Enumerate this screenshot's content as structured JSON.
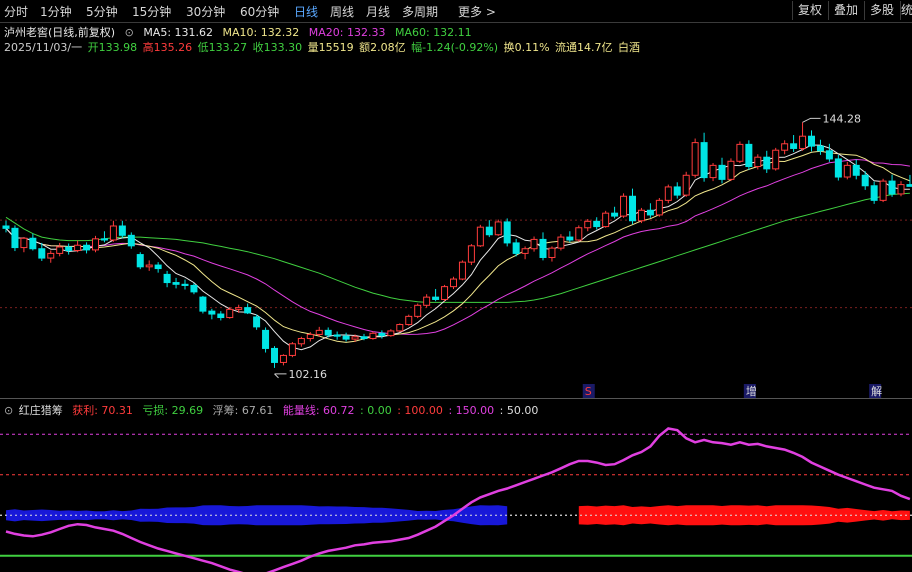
{
  "toolbar": {
    "tabs": [
      "分时",
      "1分钟",
      "5分钟",
      "15分钟",
      "30分钟",
      "60分钟",
      "日线",
      "周线",
      "月线",
      "多周期",
      "更多 >"
    ],
    "active_tab": "日线",
    "right_buttons": [
      "复权",
      "叠加",
      "多股",
      "统"
    ]
  },
  "header": {
    "stock": "泸州老窖(日线,前复权)",
    "ma5": "MA5: 131.62",
    "ma10": "MA10: 132.32",
    "ma20": "MA20: 132.33",
    "ma60": "MA60: 132.11",
    "date": "2025/11/03/一",
    "open": "开133.98",
    "high": "高135.26",
    "low": "低133.27",
    "close": "收133.30",
    "volume": "量15519",
    "amount": "额2.08亿",
    "change": "幅-1.24(-0.92%)",
    "turnover": "换0.11%",
    "float": "流通14.7亿",
    "sector": "白酒"
  },
  "indicator": {
    "name": "红庄猎筹",
    "profit": "获利: 70.31",
    "loss": "亏损: 29.69",
    "float_chips": "浮筹: 67.61",
    "energy": "能量线: 60.72",
    "v0": ": 0.00",
    "v100": ": 100.00",
    "v150": ": 150.00",
    "v50": ": 50.00"
  },
  "markers": {
    "s": "S",
    "zeng": "增",
    "jie": "解"
  },
  "colors": {
    "up": "#ff3c3c",
    "down": "#00e5e5",
    "ma5": "#e8e8e8",
    "ma10": "#f0e68c",
    "ma20": "#e040e0",
    "ma60": "#40d040",
    "energy": "#e040e0",
    "blue_band": "#1818d8",
    "red_band": "#ff1010"
  },
  "chart_data": {
    "type": "candlestick",
    "annotations": {
      "max_label": "144.28",
      "min_label": "102.16"
    },
    "candles": [
      [
        126.5,
        127.4,
        125.4,
        126.1
      ],
      [
        126.1,
        126.6,
        122.2,
        122.8
      ],
      [
        122.8,
        124.6,
        122.0,
        124.4
      ],
      [
        124.4,
        125.2,
        122.3,
        122.6
      ],
      [
        122.6,
        123.6,
        120.5,
        121.0
      ],
      [
        121.0,
        122.3,
        120.2,
        121.8
      ],
      [
        121.8,
        123.6,
        121.3,
        122.9
      ],
      [
        122.9,
        123.5,
        121.6,
        122.3
      ],
      [
        122.3,
        124.0,
        122.0,
        123.2
      ],
      [
        123.2,
        123.7,
        121.8,
        122.4
      ],
      [
        122.4,
        124.8,
        122.0,
        124.3
      ],
      [
        124.3,
        125.6,
        123.7,
        124.1
      ],
      [
        124.1,
        127.4,
        123.8,
        126.5
      ],
      [
        126.5,
        127.4,
        124.4,
        124.9
      ],
      [
        124.9,
        125.4,
        122.6,
        123.1
      ],
      [
        121.6,
        122.0,
        119.1,
        119.5
      ],
      [
        119.5,
        120.6,
        118.8,
        119.8
      ],
      [
        119.8,
        120.3,
        118.5,
        119.2
      ],
      [
        118.2,
        118.8,
        116.0,
        116.8
      ],
      [
        116.8,
        117.6,
        115.8,
        116.5
      ],
      [
        116.5,
        117.3,
        115.6,
        116.3
      ],
      [
        116.3,
        116.7,
        114.8,
        115.2
      ],
      [
        114.3,
        114.5,
        111.5,
        111.9
      ],
      [
        111.9,
        112.3,
        110.5,
        111.4
      ],
      [
        111.4,
        111.9,
        110.3,
        110.8
      ],
      [
        110.8,
        112.6,
        110.6,
        112.2
      ],
      [
        112.2,
        113.0,
        111.6,
        112.5
      ],
      [
        112.5,
        113.2,
        111.4,
        111.6
      ],
      [
        110.9,
        111.3,
        108.7,
        109.2
      ],
      [
        108.6,
        109.1,
        104.8,
        105.5
      ],
      [
        105.5,
        105.9,
        102.16,
        103.1
      ],
      [
        103.1,
        104.5,
        102.6,
        104.3
      ],
      [
        104.3,
        106.6,
        104.0,
        106.3
      ],
      [
        106.3,
        107.5,
        105.8,
        107.2
      ],
      [
        107.2,
        108.3,
        106.7,
        107.9
      ],
      [
        107.9,
        109.2,
        107.5,
        108.6
      ],
      [
        108.6,
        109.1,
        107.4,
        107.8
      ],
      [
        107.8,
        108.4,
        107.0,
        107.6
      ],
      [
        107.6,
        108.2,
        106.7,
        107.1
      ],
      [
        107.1,
        107.9,
        106.6,
        107.5
      ],
      [
        107.5,
        108.0,
        106.9,
        107.2
      ],
      [
        107.2,
        108.4,
        107.0,
        108.1
      ],
      [
        108.1,
        108.6,
        107.2,
        107.7
      ],
      [
        107.7,
        108.8,
        107.5,
        108.5
      ],
      [
        108.5,
        109.8,
        108.3,
        109.6
      ],
      [
        109.6,
        111.3,
        109.4,
        111.0
      ],
      [
        111.0,
        113.2,
        110.7,
        112.9
      ],
      [
        112.9,
        114.8,
        112.5,
        114.3
      ],
      [
        114.3,
        115.7,
        113.6,
        113.9
      ],
      [
        113.9,
        116.4,
        113.6,
        116.1
      ],
      [
        116.1,
        117.8,
        115.7,
        117.4
      ],
      [
        117.4,
        120.6,
        117.2,
        120.3
      ],
      [
        120.3,
        123.4,
        119.8,
        123.1
      ],
      [
        123.1,
        126.7,
        122.9,
        126.3
      ],
      [
        126.3,
        127.5,
        124.6,
        125.0
      ],
      [
        125.0,
        127.6,
        124.8,
        127.2
      ],
      [
        127.2,
        127.8,
        123.0,
        123.6
      ],
      [
        123.6,
        124.3,
        121.3,
        121.8
      ],
      [
        121.8,
        123.0,
        120.8,
        122.6
      ],
      [
        122.6,
        124.7,
        122.1,
        124.2
      ],
      [
        124.2,
        125.4,
        120.6,
        121.1
      ],
      [
        121.1,
        123.0,
        120.4,
        122.7
      ],
      [
        122.7,
        125.1,
        122.3,
        124.6
      ],
      [
        124.6,
        125.6,
        123.7,
        124.1
      ],
      [
        124.1,
        126.6,
        123.8,
        126.2
      ],
      [
        126.2,
        127.7,
        125.6,
        127.3
      ],
      [
        127.3,
        128.0,
        125.9,
        126.4
      ],
      [
        126.4,
        129.1,
        126.2,
        128.7
      ],
      [
        128.7,
        129.8,
        127.8,
        128.2
      ],
      [
        128.2,
        132.1,
        127.9,
        131.6
      ],
      [
        131.6,
        132.9,
        126.8,
        127.4
      ],
      [
        127.4,
        129.6,
        127.0,
        129.2
      ],
      [
        129.2,
        130.4,
        127.9,
        128.4
      ],
      [
        128.4,
        131.3,
        128.1,
        130.9
      ],
      [
        130.9,
        133.6,
        130.4,
        133.2
      ],
      [
        133.2,
        134.0,
        131.2,
        131.8
      ],
      [
        131.8,
        135.8,
        131.5,
        135.2
      ],
      [
        135.2,
        141.5,
        134.8,
        140.8
      ],
      [
        140.8,
        142.5,
        134.1,
        134.8
      ],
      [
        134.8,
        137.3,
        134.2,
        136.9
      ],
      [
        136.9,
        138.2,
        133.8,
        134.5
      ],
      [
        134.5,
        138.1,
        134.2,
        137.6
      ],
      [
        137.6,
        141.0,
        137.3,
        140.5
      ],
      [
        140.5,
        141.2,
        136.1,
        136.7
      ],
      [
        136.7,
        138.8,
        136.2,
        138.3
      ],
      [
        138.3,
        139.4,
        135.6,
        136.3
      ],
      [
        136.3,
        139.9,
        136.0,
        139.5
      ],
      [
        139.5,
        141.2,
        138.8,
        140.6
      ],
      [
        140.6,
        142.1,
        139.2,
        139.8
      ],
      [
        139.8,
        144.28,
        139.4,
        141.9
      ],
      [
        141.9,
        142.9,
        139.3,
        140.2
      ],
      [
        140.2,
        141.3,
        138.7,
        139.4
      ],
      [
        139.4,
        140.6,
        137.5,
        138.0
      ],
      [
        138.0,
        138.7,
        134.3,
        134.9
      ],
      [
        134.9,
        137.5,
        134.5,
        136.9
      ],
      [
        136.9,
        137.9,
        134.5,
        135.2
      ],
      [
        135.2,
        135.9,
        132.7,
        133.4
      ],
      [
        133.4,
        134.1,
        130.3,
        130.9
      ],
      [
        130.9,
        134.6,
        130.6,
        134.2
      ],
      [
        134.2,
        135.3,
        131.5,
        132.0
      ],
      [
        132.0,
        134.2,
        131.6,
        133.6
      ],
      [
        133.6,
        135.26,
        133.27,
        133.3
      ]
    ],
    "ma60": [
      128.0,
      127.0,
      126.0,
      125.2,
      124.6,
      124.3,
      124.1,
      124.0,
      124.0,
      124.0,
      124.1,
      124.3,
      124.5,
      124.6,
      124.6,
      124.6,
      124.5,
      124.4,
      124.3,
      124.2,
      124.0,
      123.8,
      123.6,
      123.3,
      123.0,
      122.7,
      122.4,
      122.1,
      121.7,
      121.3,
      120.9,
      120.4,
      119.9,
      119.4,
      118.9,
      118.4,
      117.8,
      117.2,
      116.6,
      116.0,
      115.5,
      115.0,
      114.6,
      114.2,
      113.9,
      113.7,
      113.5,
      113.4,
      113.4,
      113.4,
      113.4,
      113.4,
      113.4,
      113.4,
      113.4,
      113.4,
      113.4,
      113.5,
      113.6,
      113.8,
      114.1,
      114.5,
      114.9,
      115.4,
      115.9,
      116.4,
      116.9,
      117.4,
      117.9,
      118.4,
      118.9,
      119.4,
      119.9,
      120.4,
      120.9,
      121.4,
      121.9,
      122.4,
      122.9,
      123.4,
      123.9,
      124.4,
      124.9,
      125.4,
      125.9,
      126.4,
      126.9,
      127.4,
      127.8,
      128.2,
      128.6,
      129.0,
      129.4,
      129.8,
      130.2,
      130.6,
      131.0,
      131.3,
      131.6,
      131.9,
      132.0,
      132.11
    ]
  },
  "indicator_data": {
    "type": "area+line",
    "ylim": [
      -20,
      170
    ],
    "energy": [
      30,
      27,
      25,
      24,
      26,
      29,
      33,
      37,
      39,
      38,
      35,
      33,
      31,
      27,
      22,
      17,
      13,
      9,
      6,
      3,
      0,
      -3,
      -6,
      -9,
      -13,
      -17,
      -20,
      -23,
      -24,
      -22,
      -18,
      -14,
      -10,
      -6,
      -1,
      3,
      6,
      8,
      10,
      13,
      14,
      16,
      17,
      18,
      20,
      22,
      26,
      31,
      36,
      43,
      50,
      58,
      66,
      72,
      76,
      80,
      83,
      87,
      91,
      95,
      99,
      103,
      108,
      113,
      117,
      117,
      115,
      112,
      113,
      118,
      124,
      128,
      135,
      148,
      157,
      155,
      145,
      140,
      143,
      140,
      139,
      137,
      140,
      137,
      138,
      135,
      133,
      131,
      127,
      122,
      115,
      110,
      105,
      100,
      96,
      92,
      88,
      84,
      82,
      80,
      74,
      70
    ]
  }
}
